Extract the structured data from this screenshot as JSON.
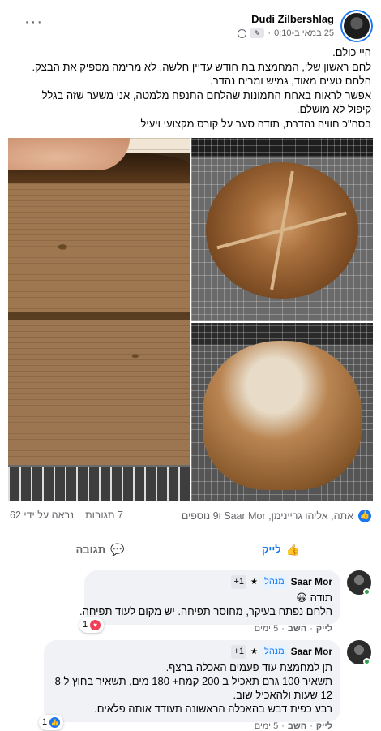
{
  "post": {
    "author": "Dudi Zilbershlag",
    "time": "25 במאי ב-0:10",
    "more_icon": "more-dots-icon",
    "text_lines": [
      "היי כולם.",
      "לחם ראשון שלי, המחמצת בת חודש עדיין חלשה, לא מרימה מספיק את הבצק.",
      "הלחם טעים מאוד, גמיש ומריח נהדר.",
      "אפשר לראות באחת התמונות שהלחם התנפח מלמטה, אני משער שזה בגלל",
      "קיפול לא מושלם.",
      "בסה\"כ חוויה נהדרת, תודה סער על קורס מקצועי ויעיל."
    ]
  },
  "engagement": {
    "reactors": "אתה, אליהו גריינימן, Saar Mor ו9 נוספים",
    "comments_count": "7 תגובות",
    "views": "נראה על ידי 62"
  },
  "actions": {
    "like_label": "לייק",
    "comment_label": "תגובה"
  },
  "comments": [
    {
      "name": "Saar Mor",
      "badge": "מנהל",
      "plus": "+1",
      "lines": [
        "תודה 😀",
        "הלחם נפתח בעיקר, מחוסר תפיחה. יש מקום לעוד תפיחה."
      ],
      "reaction_count": "1",
      "reaction_type": "heart",
      "footer_like": "לייק",
      "footer_reply": "השב",
      "footer_time": "5 ימים"
    },
    {
      "name": "Saar Mor",
      "badge": "מנהל",
      "plus": "+1",
      "lines": [
        "תן למחמצת עוד פעמים האכלה ברצף.",
        "תשאיר 100 גרם תאכיל ב 200 קמח+ 180 מים, תשאיר בחוץ ל 8-",
        "12 שעות ולהאכיל שוב.",
        "רבע כפית דבש בהאכלה הראשונה תעודד אותה פלאים."
      ],
      "reaction_count": "1",
      "reaction_type": "like",
      "footer_like": "לייק",
      "footer_reply": "השב",
      "footer_time": "5 ימים"
    }
  ]
}
